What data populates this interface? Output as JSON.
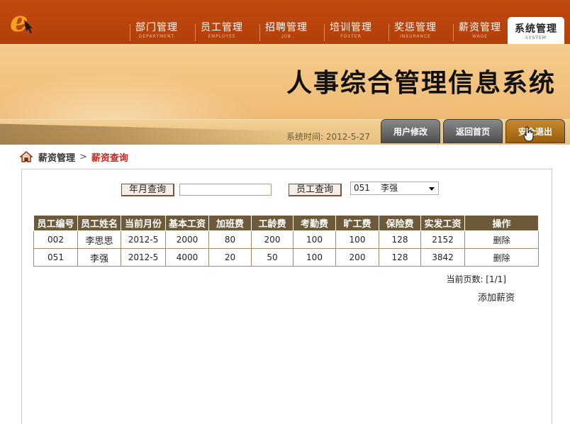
{
  "nav": {
    "items": [
      {
        "label": "部门管理",
        "sub": "DEPARTMENT"
      },
      {
        "label": "员工管理",
        "sub": "EMPLOYEE"
      },
      {
        "label": "招聘管理",
        "sub": "JOB"
      },
      {
        "label": "培训管理",
        "sub": "FOSTER"
      },
      {
        "label": "奖惩管理",
        "sub": "INSURANCE"
      },
      {
        "label": "薪资管理",
        "sub": "WAGE"
      },
      {
        "label": "系统管理",
        "sub": "SYSTEM"
      }
    ],
    "active_index": 6
  },
  "banner": {
    "title": "人事综合管理信息系统",
    "system_time": "系统时间: 2012-5-27",
    "buttons": {
      "user_edit": "用户修改",
      "home": "返回首页",
      "logout": "安全退出"
    }
  },
  "breadcrumb": {
    "section": "薪资管理",
    "current": "薪资查询"
  },
  "query": {
    "month_button": "年月查询",
    "month_value": "",
    "employee_button": "员工查询",
    "employee_selected": "051    李强"
  },
  "table": {
    "headers": [
      "员工编号",
      "员工姓名",
      "当前月份",
      "基本工资",
      "加班费",
      "工龄费",
      "考勤费",
      "旷工费",
      "保险费",
      "实发工资",
      "操作"
    ],
    "rows": [
      [
        "002",
        "李思思",
        "2012-5",
        "2000",
        "80",
        "200",
        "100",
        "100",
        "128",
        "2152",
        "删除"
      ],
      [
        "051",
        "李强",
        "2012-5",
        "4000",
        "20",
        "50",
        "100",
        "200",
        "128",
        "3842",
        "删除"
      ]
    ]
  },
  "pager": "当前页数: [1/1]",
  "add_link": "添加薪资",
  "colors": {
    "topbar": "#b8440d",
    "banner": "#f0be78",
    "table_header": "#6c5a3a",
    "accent_red": "#c0281e"
  },
  "icons": {
    "logo": "e-logo-icon",
    "home": "home-icon",
    "select_arrow": "chevron-down-icon",
    "cursor": "hand-cursor-icon"
  }
}
